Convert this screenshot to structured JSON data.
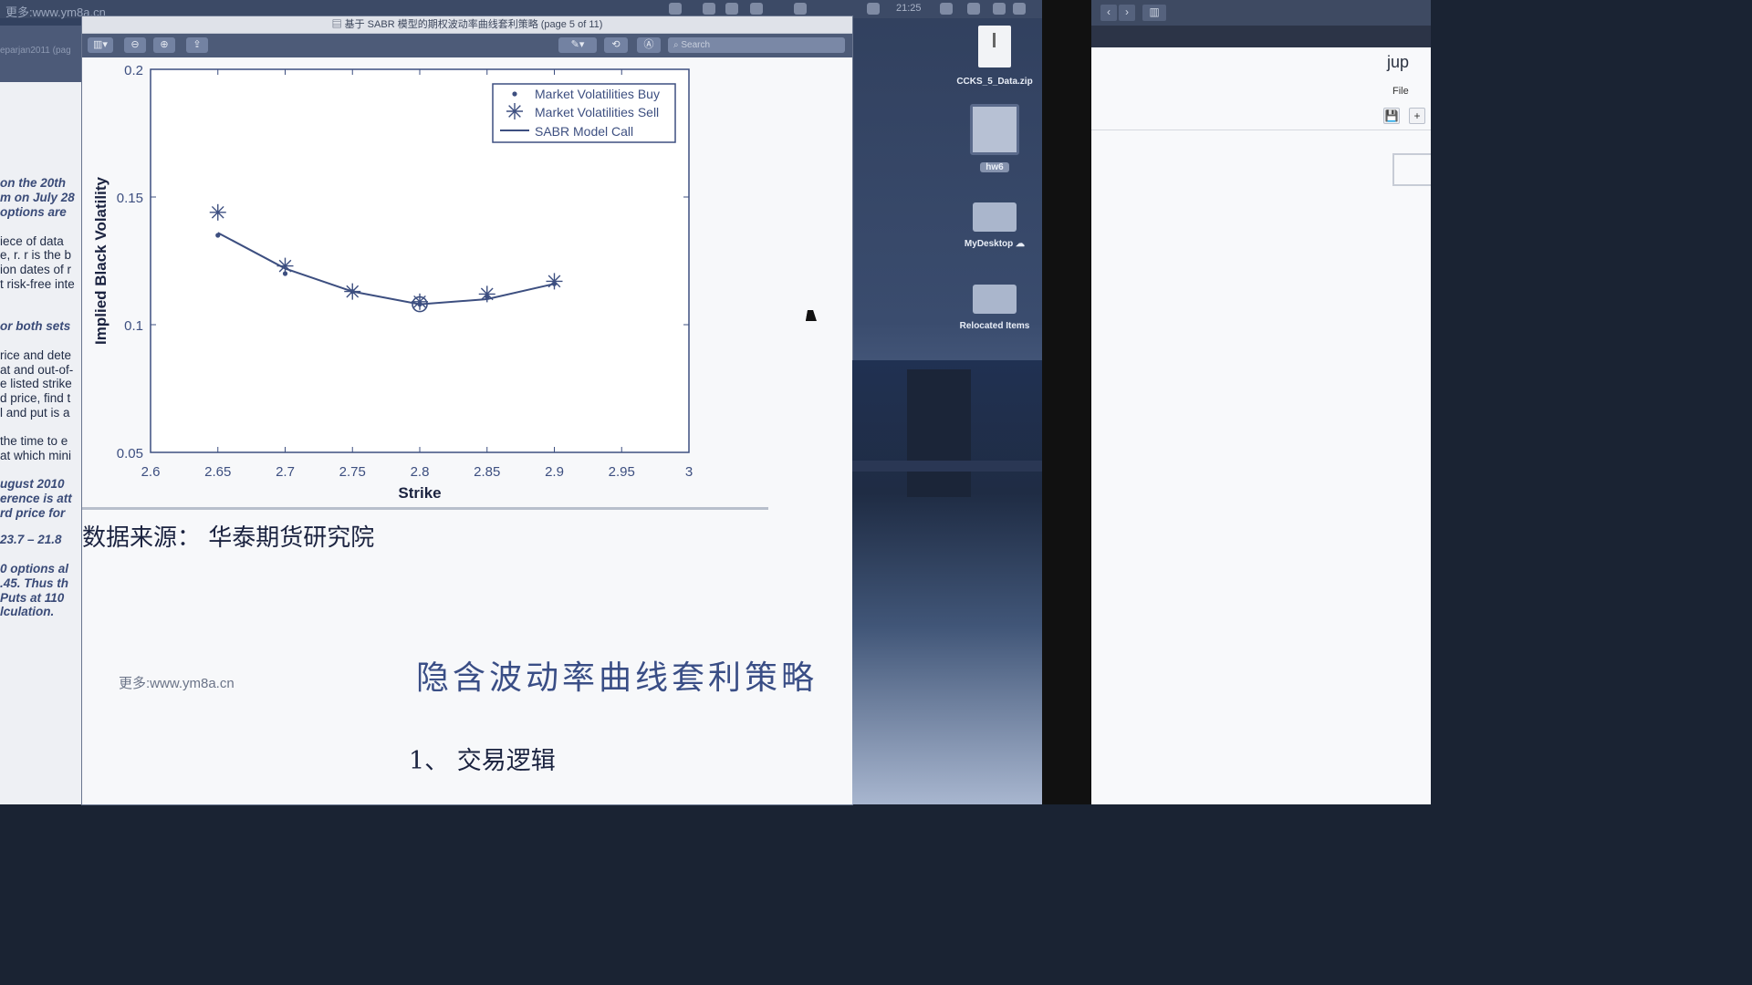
{
  "menubar": {
    "watermark": "更多:www.ym8a.cn",
    "clock": "21:25"
  },
  "backdoc": {
    "tab": "eparjan2011 (pag",
    "lines": [
      {
        "text": "on the 20th",
        "style": "it"
      },
      {
        "text": "m on July 28",
        "style": "it"
      },
      {
        "text": " options are",
        "style": "it"
      },
      {
        "text": "iece of data",
        "style": ""
      },
      {
        "text": "e, r. r is the b",
        "style": ""
      },
      {
        "text": "ion dates of r",
        "style": ""
      },
      {
        "text": "t risk-free inte",
        "style": ""
      },
      {
        "text": "or both sets",
        "style": "it"
      },
      {
        "text": "rice and dete",
        "style": ""
      },
      {
        "text": "at and out-of-",
        "style": ""
      },
      {
        "text": "e listed strike",
        "style": ""
      },
      {
        "text": "d price, find t",
        "style": ""
      },
      {
        "text": "l and put is a",
        "style": ""
      },
      {
        "text": "the time to e",
        "style": ""
      },
      {
        "text": "at which mini",
        "style": ""
      },
      {
        "text": "ugust 2010 ",
        "style": "it"
      },
      {
        "text": "erence is att",
        "style": "it"
      },
      {
        "text": "rd price for",
        "style": "it"
      },
      {
        "text": "23.7 – 21.8",
        "style": "it"
      },
      {
        "text": "0 options al",
        "style": "it"
      },
      {
        "text": ".45. Thus th",
        "style": "it"
      },
      {
        "text": " Puts at 110",
        "style": "it"
      },
      {
        "text": "lculation.",
        "style": "it"
      }
    ]
  },
  "window": {
    "title": "基于 SABR 模型的期权波动率曲线套利策略 (page 5 of 11)",
    "search_placeholder": "Search"
  },
  "chart_data": {
    "type": "line",
    "xlabel": "Strike",
    "ylabel": "Implied Black Volatility",
    "xlim": [
      2.6,
      3.0
    ],
    "ylim": [
      0.05,
      0.2
    ],
    "xticks": [
      "2.6",
      "2.65",
      "2.7",
      "2.75",
      "2.8",
      "2.85",
      "2.9",
      "2.95",
      "3"
    ],
    "yticks": [
      "0.05",
      "0.1",
      "0.15",
      "0.2"
    ],
    "legend_position": "top-right",
    "series": [
      {
        "name": "Market Volatilities Buy",
        "marker": "dot",
        "x": [
          2.65,
          2.7,
          2.75,
          2.8,
          2.85,
          2.9
        ],
        "y": [
          0.135,
          0.12,
          0.113,
          0.108,
          0.111,
          0.116
        ]
      },
      {
        "name": "Market Volatilities Sell",
        "marker": "star",
        "x": [
          2.65,
          2.7,
          2.75,
          2.8,
          2.85,
          2.9
        ],
        "y": [
          0.144,
          0.123,
          0.113,
          0.109,
          0.112,
          0.117
        ]
      },
      {
        "name": "SABR Model Call",
        "marker": "line",
        "x": [
          2.65,
          2.7,
          2.75,
          2.8,
          2.85,
          2.9
        ],
        "y": [
          0.136,
          0.122,
          0.113,
          0.108,
          0.11,
          0.116
        ]
      }
    ],
    "highlight": {
      "x": 2.8,
      "y": 0.108
    }
  },
  "page": {
    "source": "数据来源： 华泰期货研究院",
    "watermark": "更多:www.ym8a.cn",
    "title": "隐含波动率曲线套利策略",
    "section": "1、 交易逻辑"
  },
  "desktop": {
    "icons": [
      {
        "label": "CCKS_5_Data.zip",
        "type": "zip"
      },
      {
        "label": "hw6",
        "type": "folder"
      },
      {
        "label": "MyDesktop",
        "type": "folder"
      },
      {
        "label": "Relocated Items",
        "type": "folder"
      }
    ]
  },
  "jupyter": {
    "logo": "jup",
    "menu_file": "File",
    "save_icon": "💾",
    "add_icon": "+"
  }
}
